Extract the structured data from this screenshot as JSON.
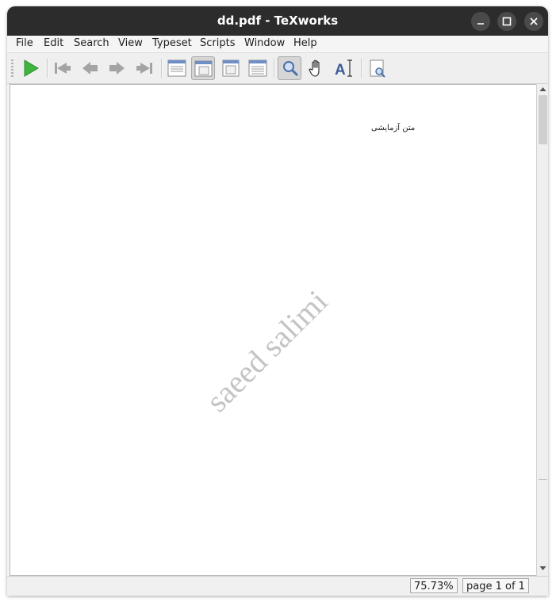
{
  "window": {
    "title": "dd.pdf - TeXworks",
    "controls": [
      "minimize-icon",
      "maximize-icon",
      "close-icon"
    ]
  },
  "menu": {
    "items": [
      "File",
      "Edit",
      "Search",
      "View",
      "Typeset",
      "Scripts",
      "Window",
      "Help"
    ]
  },
  "toolbar": {
    "buttons": [
      {
        "icon": "play-icon",
        "name": "typeset"
      },
      {
        "icon": "first-page-icon",
        "name": "first-page"
      },
      {
        "icon": "previous-page-icon",
        "name": "previous-page"
      },
      {
        "icon": "next-page-icon",
        "name": "next-page"
      },
      {
        "icon": "last-page-icon",
        "name": "last-page"
      },
      {
        "icon": "actual-size-icon",
        "name": "actual-size"
      },
      {
        "icon": "fit-width-icon",
        "name": "fit-width",
        "active": true
      },
      {
        "icon": "fit-page-icon",
        "name": "fit-page"
      },
      {
        "icon": "continuous-icon",
        "name": "continuous"
      },
      {
        "icon": "magnify-icon",
        "name": "magnify",
        "active": true
      },
      {
        "icon": "hand-icon",
        "name": "scroll"
      },
      {
        "icon": "select-text-icon",
        "name": "select-text"
      },
      {
        "icon": "find-icon",
        "name": "find"
      }
    ]
  },
  "document": {
    "rtl_text": "متن آزمایشی",
    "watermark": "saeed salimi"
  },
  "status": {
    "zoom": "75.73%",
    "page": "page 1 of 1"
  },
  "colors": {
    "titlebar": "#2c2c2c",
    "play": "#3fb53f",
    "watermark": "#c4c4c4"
  }
}
